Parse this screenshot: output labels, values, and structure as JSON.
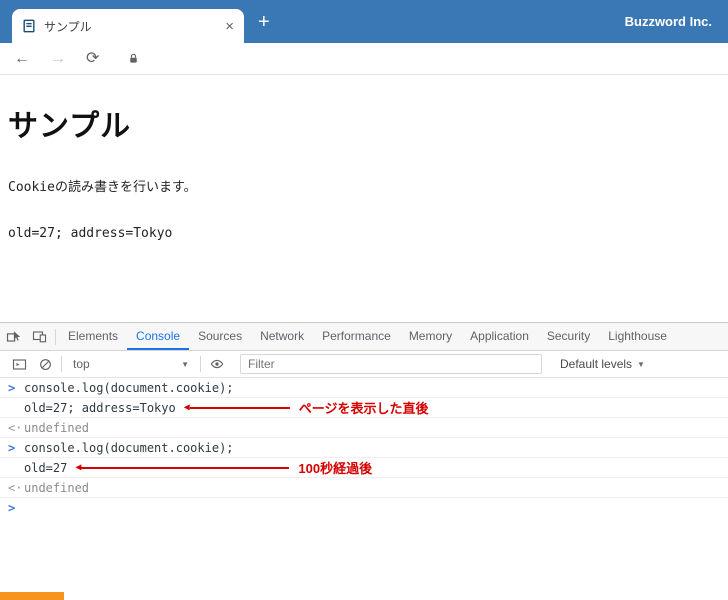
{
  "browser": {
    "brand": "Buzzword Inc.",
    "tab_title": "サンプル",
    "new_tab_label": "+",
    "close_label": "×"
  },
  "icons": {
    "back": "←",
    "forward": "→",
    "reload": "⟳",
    "caret_down": "▼",
    "arrow_head_left": "◀"
  },
  "page": {
    "heading": "サンプル",
    "paragraph": "Cookieの読み書きを行います。",
    "cookie_value": "old=27; address=Tokyo"
  },
  "devtools": {
    "tabs": [
      "Elements",
      "Console",
      "Sources",
      "Network",
      "Performance",
      "Memory",
      "Application",
      "Security",
      "Lighthouse"
    ],
    "active_tab": "Console",
    "toolbar": {
      "context": "top",
      "filter_placeholder": "Filter",
      "levels_label": "Default levels"
    },
    "console_rows": [
      {
        "marker": ">",
        "text": "console.log(document.cookie);"
      },
      {
        "marker": "",
        "text": "old=27; address=Tokyo",
        "annotation": "ページを表示した直後"
      },
      {
        "marker": "<·",
        "text": "undefined"
      },
      {
        "marker": ">",
        "text": "console.log(document.cookie);"
      },
      {
        "marker": "",
        "text": "old=27",
        "annotation": "100秒経過後"
      },
      {
        "marker": "<·",
        "text": "undefined"
      },
      {
        "marker": ">",
        "text": ""
      }
    ]
  }
}
